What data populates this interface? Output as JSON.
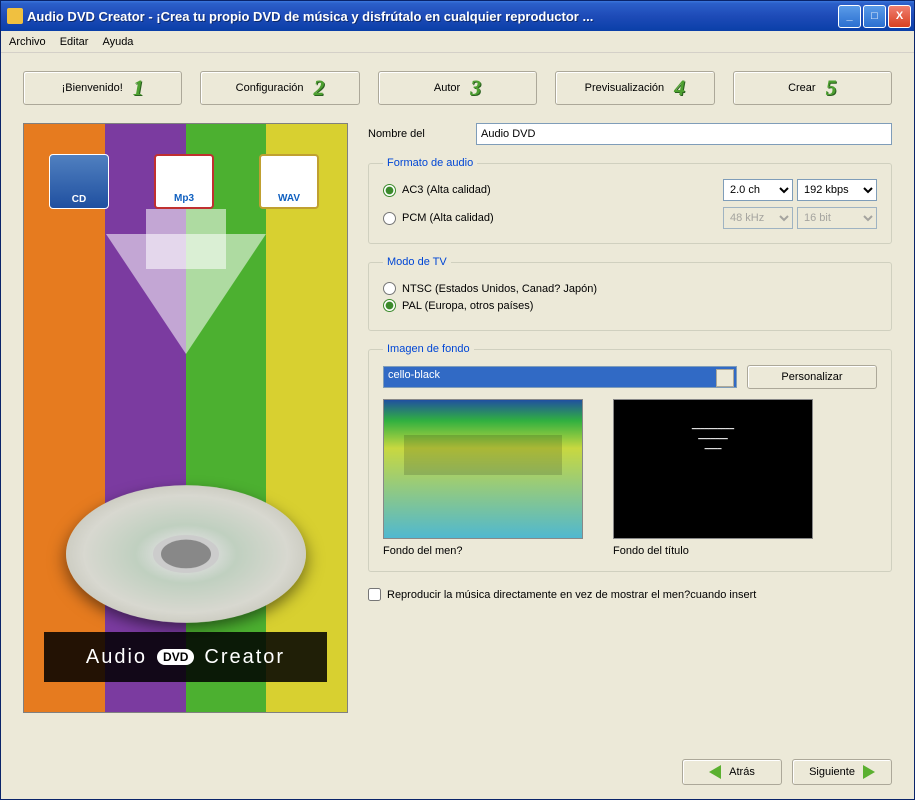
{
  "window": {
    "title": "Audio DVD Creator - ¡Crea tu propio DVD de música y disfrútalo en cualquier reproductor ..."
  },
  "menu": {
    "file": "Archivo",
    "edit": "Editar",
    "help": "Ayuda"
  },
  "steps": [
    {
      "label": "¡Bienvenido!",
      "num": "1"
    },
    {
      "label": "Configuración",
      "num": "2"
    },
    {
      "label": "Autor",
      "num": "3"
    },
    {
      "label": "Previsualización",
      "num": "4"
    },
    {
      "label": "Crear",
      "num": "5"
    }
  ],
  "sideImage": {
    "cd": "CD",
    "mp3": "Mp3",
    "wav": "WAV",
    "caption_left": "Audio",
    "caption_mid": "DVD",
    "caption_right": "Creator"
  },
  "nameField": {
    "label": "Nombre del",
    "value": "Audio DVD"
  },
  "audioFormat": {
    "legend": "Formato de audio",
    "ac3": "AC3 (Alta calidad)",
    "pcm": "PCM (Alta calidad)",
    "channels": "2.0 ch",
    "bitrate": "192 kbps",
    "samplerate": "48 kHz",
    "bitdepth": "16 bit",
    "selected": "ac3"
  },
  "tvMode": {
    "legend": "Modo de TV",
    "ntsc": "NTSC (Estados Unidos, Canad? Japón)",
    "pal": "PAL (Europa, otros países)",
    "selected": "pal"
  },
  "background": {
    "legend": "Imagen de fondo",
    "selected": "cello-black",
    "customize": "Personalizar",
    "menuLabel": "Fondo del men?",
    "titleLabel": "Fondo del título"
  },
  "playDirect": {
    "label": "Reproducir la música directamente en vez de mostrar el men?cuando insert",
    "checked": false
  },
  "nav": {
    "back": "Atrás",
    "next": "Siguiente"
  }
}
